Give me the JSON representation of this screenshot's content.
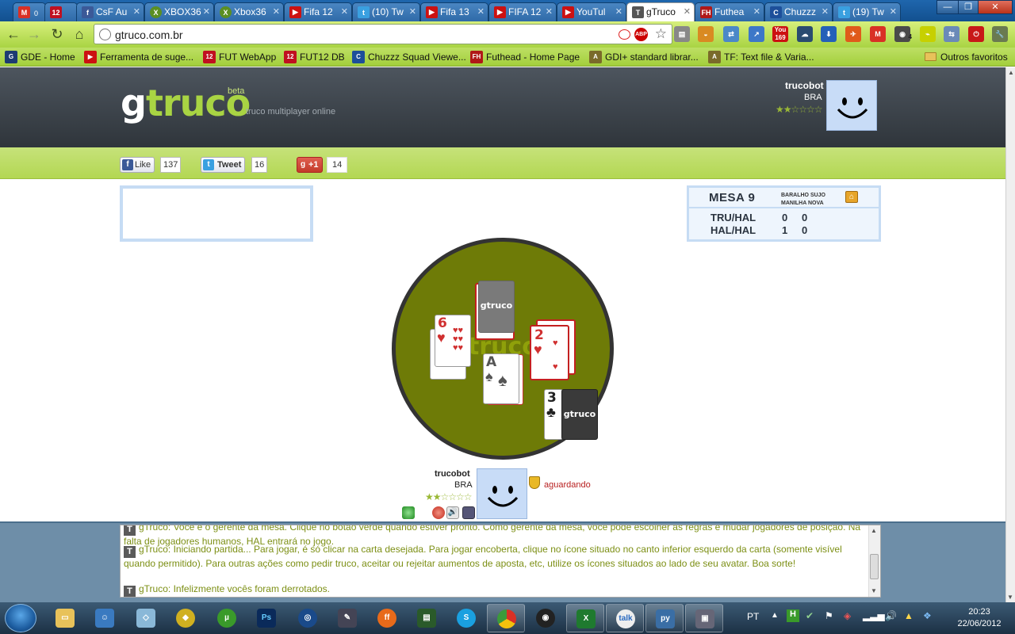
{
  "browser": {
    "tabs": [
      {
        "label": "",
        "icon": "gmail-icon",
        "color": "#d93025"
      },
      {
        "label": "",
        "icon": "fut-12-icon",
        "color": "#c01020"
      },
      {
        "label": "CsF Au",
        "icon": "facebook-icon",
        "color": "#3b5998"
      },
      {
        "label": "XBOX36",
        "icon": "xbox-icon",
        "color": "#5b8f22"
      },
      {
        "label": "Xbox36",
        "icon": "xbox-icon",
        "color": "#5b8f22"
      },
      {
        "label": "Fifa 12",
        "icon": "youtube-icon",
        "color": "#cc1111"
      },
      {
        "label": "(10) Tw",
        "icon": "twitter-icon",
        "color": "#3aa0e0"
      },
      {
        "label": "Fifa 13",
        "icon": "youtube-icon",
        "color": "#cc1111"
      },
      {
        "label": "FIFA 12",
        "icon": "youtube-icon",
        "color": "#cc1111"
      },
      {
        "label": "YouTul",
        "icon": "youtube-icon",
        "color": "#cc1111"
      },
      {
        "label": "gTruco",
        "icon": "gtruco-icon",
        "color": "#555555"
      },
      {
        "label": "Futhea",
        "icon": "futhead-icon",
        "color": "#b01818"
      },
      {
        "label": "Chuzzz",
        "icon": "chuzzz-icon",
        "color": "#1d4f9a"
      },
      {
        "label": "(19) Tw",
        "icon": "twitter-icon",
        "color": "#3aa0e0"
      }
    ],
    "gmail_count": "0",
    "url": "gtruco.com.br",
    "youtube_badge": "169",
    "ext_badge": "4",
    "bookmarks": [
      {
        "label": "GDE - Home",
        "icon": "gde-icon",
        "color": "#1d3b72"
      },
      {
        "label": "Ferramenta de suge...",
        "icon": "youtube-icon",
        "color": "#cc1111"
      },
      {
        "label": "FUT WebApp",
        "icon": "fut-12-icon",
        "color": "#c01020"
      },
      {
        "label": "FUT12 DB",
        "icon": "fut-12-icon",
        "color": "#c01020"
      },
      {
        "label": "Chuzzz Squad Viewe...",
        "icon": "chuzzz-icon",
        "color": "#1d4f9a"
      },
      {
        "label": "Futhead - Home Page",
        "icon": "futhead-icon",
        "color": "#b01818"
      },
      {
        "label": "GDI+ standard librar...",
        "icon": "page-icon",
        "color": "#7a6a2a"
      },
      {
        "label": "TF: Text file & Varia...",
        "icon": "page-icon",
        "color": "#7a6a2a"
      }
    ],
    "other_bookmarks": "Outros favoritos"
  },
  "site": {
    "logo_g": "g",
    "logo_rest": "truco",
    "beta": "beta",
    "tagline": "truco multiplayer online",
    "top_player": {
      "name": "trucobot",
      "country": "BRA",
      "stars_on": "★★",
      "stars_off": "☆☆☆☆"
    },
    "social": {
      "like_label": "Like",
      "like_count": "137",
      "tweet_label": "Tweet",
      "tweet_count": "16",
      "plus_label": "+1",
      "plus_count": "14"
    },
    "mesa": {
      "title": "MESA 9",
      "rule1": "BARALHO SUJO",
      "rule2": "MANILHA NOVA",
      "rows": [
        {
          "team": "TRU/HAL",
          "a": "0",
          "b": "0"
        },
        {
          "team": "HAL/HAL",
          "a": "1",
          "b": "0"
        }
      ]
    },
    "table": {
      "watermark": "truco",
      "card_back_text": "gtruco",
      "cards": [
        {
          "rank": "6",
          "suit": "♥"
        },
        {
          "rank": "2",
          "suit": "♥"
        },
        {
          "rank": "A",
          "suit": "♠"
        },
        {
          "rank": "3",
          "suit": "♣"
        }
      ]
    },
    "bottom_player": {
      "name": "trucobot",
      "country": "BRA",
      "stars_on": "★★",
      "stars_off": "☆☆☆☆",
      "status": "aguardando"
    },
    "chat": [
      "gTruco: Você é o gerente da mesa. Clique no botão verde quando estiver pronto. Como gerente da mesa, você pode escolher as regras e mudar jogadores de posição. Na falta de jogadores humanos, HAL entrará no jogo.",
      "gTruco: Iniciando partida... Para jogar, é só clicar na carta desejada. Para jogar encoberta, clique no ícone situado no canto inferior esquerdo da carta (somente visível quando permitido). Para outras ações como pedir truco, aceitar ou rejeitar aumentos de aposta, etc, utilize os ícones situados ao lado de seu avatar. Boa sorte!",
      "gTruco: Infelizmente vocês foram derrotados."
    ],
    "chat_icon": "T"
  },
  "taskbar": {
    "language": "PT",
    "time": "20:23",
    "date": "22/06/2012"
  },
  "colors": {
    "accent": "#a9d443",
    "table": "#6e7b07",
    "header": "#3a4148"
  }
}
